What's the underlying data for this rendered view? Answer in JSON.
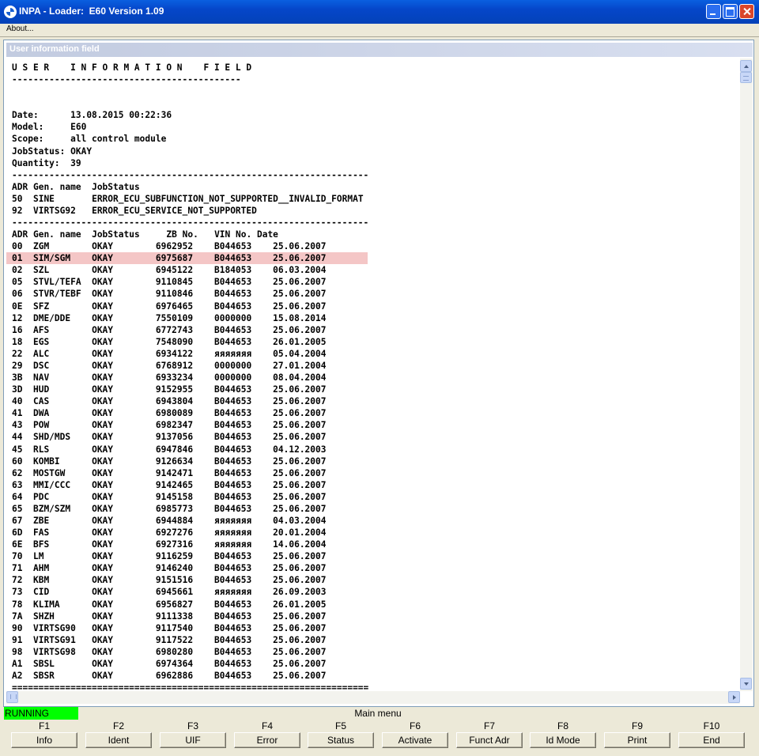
{
  "window": {
    "title": "INPA - Loader:  E60 Version 1.09",
    "menu_about": "About..."
  },
  "panel": {
    "title": "User information field",
    "heading": "U S E R    I N F O R M A T I O N    F I E L D",
    "date_label": "Date:",
    "date": "13.08.2015 00:22:36",
    "model_label": "Model:",
    "model": "E60",
    "scope_label": "Scope:",
    "scope": "all control module",
    "jobstatus_label": "JobStatus:",
    "jobstatus": "OKAY",
    "quantity_label": "Quantity:",
    "quantity": "39"
  },
  "error_table": {
    "columns": [
      "ADR",
      "Gen. name",
      "JobStatus"
    ],
    "rows": [
      [
        "50",
        "SINE",
        "ERROR_ECU_SUBFUNCTION_NOT_SUPPORTED__INVALID_FORMAT"
      ],
      [
        "92",
        "VIRTSG92",
        "ERROR_ECU_SERVICE_NOT_SUPPORTED"
      ]
    ]
  },
  "module_table": {
    "columns": [
      "ADR",
      "Gen. name",
      "JobStatus",
      "ZB No.",
      "VIN No.",
      "Date"
    ],
    "highlighted_adr": "02",
    "rows": [
      [
        "00",
        "ZGM",
        "OKAY",
        "6962952",
        "B044653",
        "25.06.2007"
      ],
      [
        "01",
        "SIM/SGM",
        "OKAY",
        "6975687",
        "B044653",
        "25.06.2007"
      ],
      [
        "02",
        "SZL",
        "OKAY",
        "6945122",
        "B184053",
        "06.03.2004"
      ],
      [
        "05",
        "STVL/TEFA",
        "OKAY",
        "9110845",
        "B044653",
        "25.06.2007"
      ],
      [
        "06",
        "STVR/TEBF",
        "OKAY",
        "9110846",
        "B044653",
        "25.06.2007"
      ],
      [
        "0E",
        "SFZ",
        "OKAY",
        "6976465",
        "B044653",
        "25.06.2007"
      ],
      [
        "12",
        "DME/DDE",
        "OKAY",
        "7550109",
        "0000000",
        "15.08.2014"
      ],
      [
        "16",
        "AFS",
        "OKAY",
        "6772743",
        "B044653",
        "25.06.2007"
      ],
      [
        "18",
        "EGS",
        "OKAY",
        "7548090",
        "B044653",
        "26.01.2005"
      ],
      [
        "22",
        "ALC",
        "OKAY",
        "6934122",
        "яяяяяяя",
        "05.04.2004"
      ],
      [
        "29",
        "DSC",
        "OKAY",
        "6768912",
        "0000000",
        "27.01.2004"
      ],
      [
        "3B",
        "NAV",
        "OKAY",
        "6933234",
        "0000000",
        "08.04.2004"
      ],
      [
        "3D",
        "HUD",
        "OKAY",
        "9152955",
        "B044653",
        "25.06.2007"
      ],
      [
        "40",
        "CAS",
        "OKAY",
        "6943804",
        "B044653",
        "25.06.2007"
      ],
      [
        "41",
        "DWA",
        "OKAY",
        "6980089",
        "B044653",
        "25.06.2007"
      ],
      [
        "43",
        "POW",
        "OKAY",
        "6982347",
        "B044653",
        "25.06.2007"
      ],
      [
        "44",
        "SHD/MDS",
        "OKAY",
        "9137056",
        "B044653",
        "25.06.2007"
      ],
      [
        "45",
        "RLS",
        "OKAY",
        "6947846",
        "B044653",
        "04.12.2003"
      ],
      [
        "60",
        "KOMBI",
        "OKAY",
        "9126634",
        "B044653",
        "25.06.2007"
      ],
      [
        "62",
        "MOSTGW",
        "OKAY",
        "9142471",
        "B044653",
        "25.06.2007"
      ],
      [
        "63",
        "MMI/CCC",
        "OKAY",
        "9142465",
        "B044653",
        "25.06.2007"
      ],
      [
        "64",
        "PDC",
        "OKAY",
        "9145158",
        "B044653",
        "25.06.2007"
      ],
      [
        "65",
        "BZM/SZM",
        "OKAY",
        "6985773",
        "B044653",
        "25.06.2007"
      ],
      [
        "67",
        "ZBE",
        "OKAY",
        "6944884",
        "яяяяяяя",
        "04.03.2004"
      ],
      [
        "6D",
        "FAS",
        "OKAY",
        "6927276",
        "яяяяяяя",
        "20.01.2004"
      ],
      [
        "6E",
        "BFS",
        "OKAY",
        "6927316",
        "яяяяяяя",
        "14.06.2004"
      ],
      [
        "70",
        "LM",
        "OKAY",
        "9116259",
        "B044653",
        "25.06.2007"
      ],
      [
        "71",
        "AHM",
        "OKAY",
        "9146240",
        "B044653",
        "25.06.2007"
      ],
      [
        "72",
        "KBM",
        "OKAY",
        "9151516",
        "B044653",
        "25.06.2007"
      ],
      [
        "73",
        "CID",
        "OKAY",
        "6945661",
        "яяяяяяя",
        "26.09.2003"
      ],
      [
        "78",
        "KLIMA",
        "OKAY",
        "6956827",
        "B044653",
        "26.01.2005"
      ],
      [
        "7A",
        "SHZH",
        "OKAY",
        "9111338",
        "B044653",
        "25.06.2007"
      ],
      [
        "90",
        "VIRTSG90",
        "OKAY",
        "9117540",
        "B044653",
        "25.06.2007"
      ],
      [
        "91",
        "VIRTSG91",
        "OKAY",
        "9117522",
        "B044653",
        "25.06.2007"
      ],
      [
        "98",
        "VIRTSG98",
        "OKAY",
        "6980280",
        "B044653",
        "25.06.2007"
      ],
      [
        "A1",
        "SBSL",
        "OKAY",
        "6974364",
        "B044653",
        "25.06.2007"
      ],
      [
        "A2",
        "SBSR",
        "OKAY",
        "6962886",
        "B044653",
        "25.06.2007"
      ]
    ]
  },
  "statusbar": {
    "status": "RUNNING",
    "status_color": "#00ff00",
    "menu_title": "Main menu"
  },
  "function_keys": [
    {
      "key": "F1",
      "label": "Info"
    },
    {
      "key": "F2",
      "label": "Ident"
    },
    {
      "key": "F3",
      "label": "UIF"
    },
    {
      "key": "F4",
      "label": "Error"
    },
    {
      "key": "F5",
      "label": "Status"
    },
    {
      "key": "F6",
      "label": "Activate"
    },
    {
      "key": "F7",
      "label": "Funct Adr"
    },
    {
      "key": "F8",
      "label": "Id Mode"
    },
    {
      "key": "F9",
      "label": "Print"
    },
    {
      "key": "F10",
      "label": "End"
    }
  ],
  "colors": {
    "titlebar": "#0546c9",
    "highlight_row": "#f4c6c6",
    "status_running": "#00ff00"
  }
}
